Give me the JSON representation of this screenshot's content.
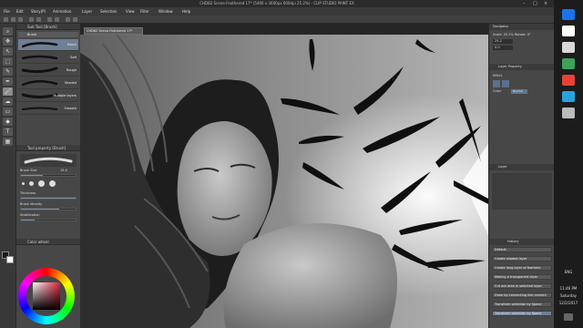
{
  "window": {
    "title": "CHD82 Scene-Feathered 17* (5400 x 3600px 600dpi 25.2%) - CLIP STUDIO PAINT EX",
    "controls": [
      "–",
      "□",
      "×"
    ]
  },
  "menu": [
    "File",
    "Edit",
    "Story(P)",
    "Animation",
    "Layer",
    "Selection",
    "View",
    "Filter",
    "Window",
    "Help"
  ],
  "toolbar": {
    "tools": [
      "zoom-tool",
      "move-tool",
      "operation-tool",
      "selection-tool",
      "eyedropper-tool",
      "pen-tool",
      "brush-tool",
      "airbrush-tool",
      "eraser-tool",
      "fill-tool",
      "text-tool",
      "ruler-tool"
    ],
    "active_index": 6
  },
  "left_panel": {
    "subtool_header": "Sub Tool [Brush]",
    "group_label": "Brush",
    "brushes": [
      "Hatch",
      "Soft",
      "Rough",
      "Shaded",
      "Multiple layers",
      "Smooth"
    ],
    "selected_brush": 0,
    "detail_header": "Tool property [Brush]",
    "brush_size_label": "Brush Size",
    "brush_size_value": "15.0",
    "thickness_label": "Thickness",
    "brush_density_label": "Brush density",
    "stabilization_label": "Stabilization",
    "color_header": "Color wheel"
  },
  "document_tab": "CHD82 Scene-Feathered 17*",
  "right_panel": {
    "navigator_header": "Navigator",
    "zoom_value": "25.2",
    "rotate_value": "0.0",
    "zoom_label": "Scale: 25.2%  Rotate: 0°",
    "layer_property_header": "Layer Property",
    "layer_mode_label": "Normal",
    "effect_label": "Effect",
    "color_label": "Color",
    "layer_header": "Layer",
    "history_header": "History",
    "history_items": [
      "Default",
      "Create shaded layer",
      "Create long layer of feathers",
      "Making a transparent layer",
      "Cut out area in selected layer",
      "Draw by connecting line corners",
      "Transform selection by Space",
      "Transform selection by Space"
    ],
    "history_selected": 7
  },
  "taskbar": {
    "time": "11:46 PM",
    "day": "Saturday",
    "date": "12/2/2017",
    "lang": "ENG",
    "icon_colors": [
      "#1a73e8",
      "#ffffff",
      "#d9d9d9",
      "#3ba35a",
      "#e94235",
      "#29a3dd"
    ]
  },
  "colors": {
    "panel_bg": "#474747",
    "selection_blue": "#6f7f94",
    "foreground_swatch": "#1a1a1a"
  }
}
